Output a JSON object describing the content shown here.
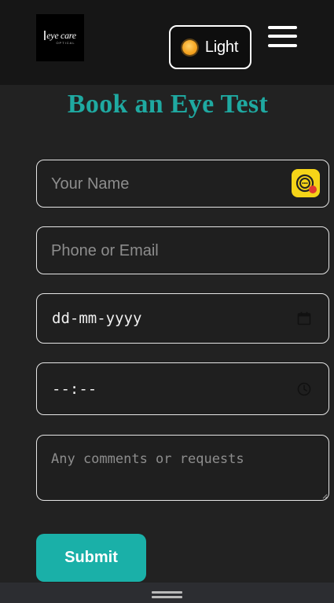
{
  "header": {
    "logo_text": "eye care",
    "logo_subtext": "OPTICAL",
    "theme_label": "Light"
  },
  "page_title": "Book an Eye Test",
  "form": {
    "name_placeholder": "Your Name",
    "contact_placeholder": "Phone or Email",
    "date_value": "dd-mm-yyyy",
    "time_value": "--:--",
    "comments_placeholder": "Any comments or requests",
    "submit_label": "Submit"
  },
  "colors": {
    "accent": "#1ab0a8",
    "title": "#1fa9a1",
    "background": "#222222",
    "header": "#161616"
  },
  "icons": {
    "theme": "sun-icon",
    "menu": "hamburger-menu-icon",
    "name_field_extension": "speech-extension-icon",
    "date": "calendar-icon",
    "time": "clock-icon",
    "bottom": "drag-handle-icon"
  }
}
